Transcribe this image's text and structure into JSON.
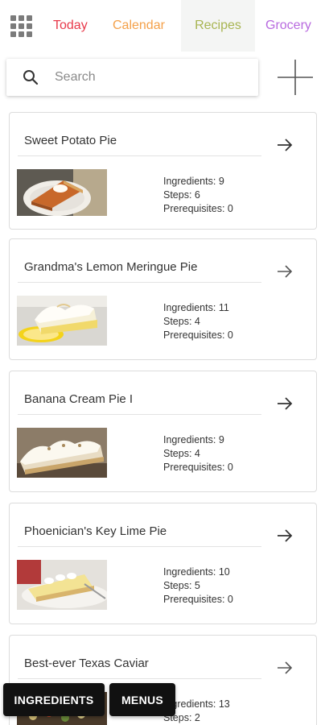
{
  "nav": {
    "tabs": [
      {
        "label": "Today",
        "color": "#e8394a"
      },
      {
        "label": "Calendar",
        "color": "#f4a14a"
      },
      {
        "label": "Recipes",
        "color": "#a8b552",
        "active": true
      },
      {
        "label": "Grocery",
        "color": "#b86adf"
      }
    ],
    "menu_icon": "grid-icon"
  },
  "search": {
    "placeholder": "Search",
    "value": "",
    "icon": "search-icon"
  },
  "add_button": {
    "icon": "plus-icon"
  },
  "stat_labels": {
    "ingredients": "Ingredients:",
    "steps": "Steps:",
    "prerequisites": "Prerequisites:"
  },
  "recipes": [
    {
      "title": "Sweet Potato Pie",
      "ingredients": "9",
      "steps": "6",
      "prerequisites": "0",
      "thumb": "pie-slice-orange"
    },
    {
      "title": "Grandma's Lemon Meringue Pie",
      "ingredients": "11",
      "steps": "4",
      "prerequisites": "0",
      "thumb": "lemon-meringue-slice"
    },
    {
      "title": "Banana Cream Pie I",
      "ingredients": "9",
      "steps": "4",
      "prerequisites": "0",
      "thumb": "banana-cream-slice"
    },
    {
      "title": "Phoenician's Key Lime Pie",
      "ingredients": "10",
      "steps": "5",
      "prerequisites": "0",
      "thumb": "key-lime-slice"
    },
    {
      "title": "Best-ever Texas Caviar",
      "ingredients": "13",
      "steps": "2",
      "prerequisites": "",
      "thumb": "bean-salad"
    }
  ],
  "bottom_buttons": {
    "ingredients": "INGREDIENTS",
    "menus": "MENUS"
  }
}
